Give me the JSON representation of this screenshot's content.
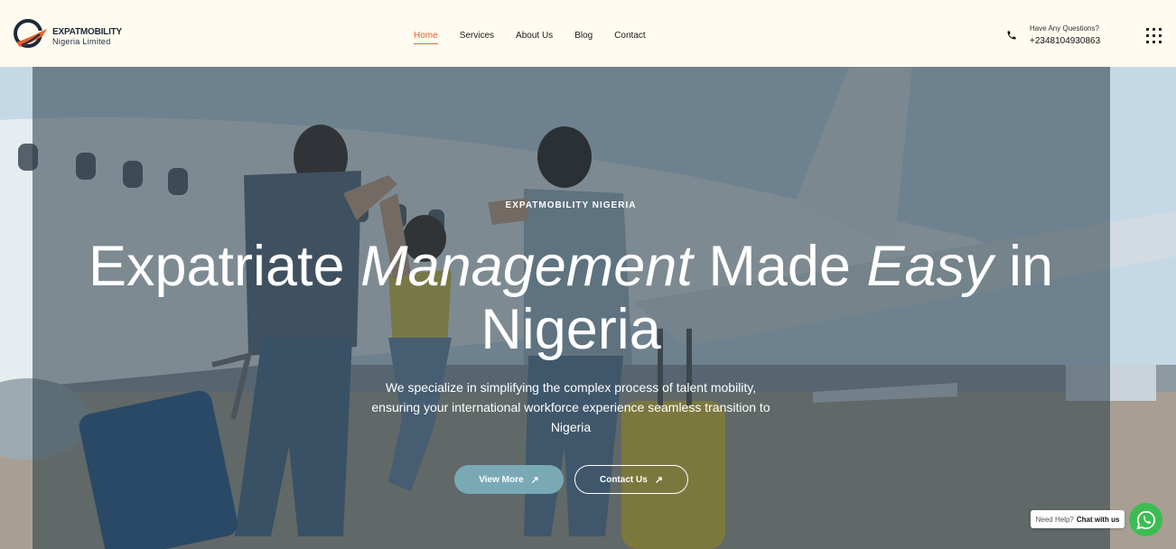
{
  "header": {
    "logo_name": "EXPATMOBILITY",
    "logo_sub": "Nigeria Limited",
    "nav": [
      {
        "label": "Home",
        "active": true
      },
      {
        "label": "Services"
      },
      {
        "label": "About Us"
      },
      {
        "label": "Blog"
      },
      {
        "label": "Contact"
      }
    ],
    "questions_label": "Have Any Questions?",
    "phone": "+2348104930863",
    "icons": {
      "phone": "phone-icon",
      "menu": "grid-menu-icon"
    }
  },
  "hero": {
    "eyebrow": "EXPATMOBILITY NIGERIA",
    "headline": {
      "part1": "Expatriate ",
      "italic1": "Management",
      "part2": " Made ",
      "italic2": "Easy",
      "part3": " in Nigeria"
    },
    "subtext": "We specialize in simplifying the complex process of talent mobility, ensuring your international workforce experience seamless transition to Nigeria",
    "buttons": {
      "view_more": "View More",
      "contact_us": "Contact Us"
    }
  },
  "chat": {
    "prefix": "Need Help?",
    "label": "Chat with us",
    "icon": "whatsapp-icon"
  },
  "colors": {
    "accent": "#e8612c",
    "header_bg": "#fffbf0",
    "primary_button": "#7aa9b6",
    "whatsapp": "#3cbd52"
  }
}
